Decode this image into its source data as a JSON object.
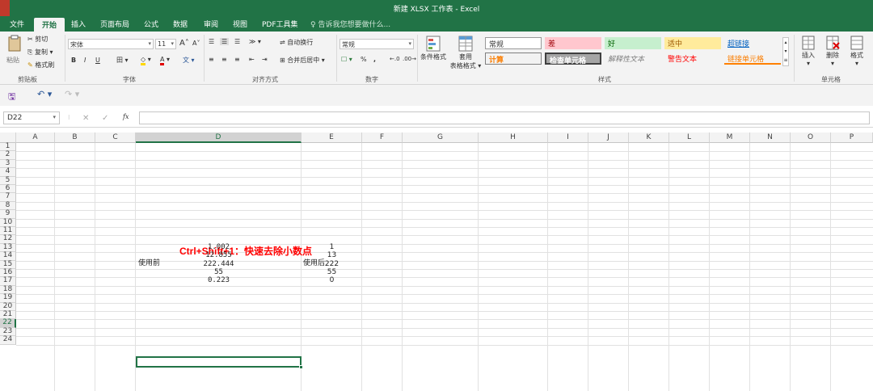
{
  "window": {
    "title": "新建 XLSX 工作表 - Excel"
  },
  "tabs": [
    "文件",
    "开始",
    "插入",
    "页面布局",
    "公式",
    "数据",
    "审阅",
    "视图",
    "PDF工具集"
  ],
  "active_tab": "开始",
  "tell_me": "告诉我您想要做什么...",
  "clipboard": {
    "paste": "粘贴",
    "cut": "剪切",
    "copy": "复制",
    "format_painter": "格式刷",
    "label": "剪贴板"
  },
  "font": {
    "name": "宋体",
    "size": "11",
    "bold": "B",
    "italic": "I",
    "underline": "U",
    "grow": "A",
    "shrink": "A",
    "label": "字体"
  },
  "alignment": {
    "wrap": "自动换行",
    "merge": "合并后居中",
    "label": "对齐方式"
  },
  "number": {
    "format": "常规",
    "percent": "%",
    "comma": ",",
    "label": "数字"
  },
  "styles": {
    "conditional": "条件格式",
    "table_format_1": "套用",
    "table_format_2": "表格格式",
    "items": [
      "常规",
      "差",
      "好",
      "适中",
      "超链接",
      "计算",
      "检查单元格",
      "解释性文本",
      "警告文本",
      "链接单元格"
    ],
    "label": "样式"
  },
  "cells_group": {
    "insert": "插入",
    "delete": "删除",
    "format": "格式",
    "label": "单元格"
  },
  "name_box": "D22",
  "formula_fx": "fx",
  "columns": [
    "A",
    "B",
    "C",
    "D",
    "E",
    "F",
    "G",
    "H",
    "I",
    "J",
    "K",
    "L",
    "M",
    "N",
    "O",
    "P"
  ],
  "rows": [
    "1",
    "2",
    "3",
    "4",
    "5",
    "6",
    "7",
    "8",
    "9",
    "10",
    "11",
    "12",
    "13",
    "14",
    "15",
    "16",
    "17",
    "18",
    "19",
    "20",
    "21",
    "22",
    "23",
    "24"
  ],
  "sheet": {
    "heading": "Ctrl+Shift+1：快速去除小数点",
    "before_label": "使用前",
    "after_label": "使用后",
    "before": [
      "1.002",
      "12.855",
      "222.444",
      "55",
      "0.223"
    ],
    "after": [
      "1",
      "13",
      "222",
      "55",
      "0"
    ]
  },
  "colors": {
    "brand": "#217346",
    "heading_red": "#ff0000"
  }
}
